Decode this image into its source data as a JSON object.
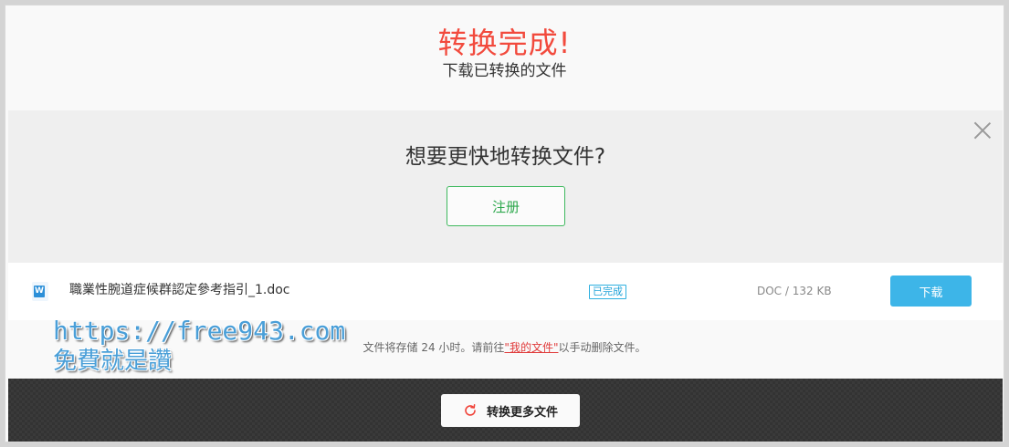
{
  "header": {
    "title": "转换完成!",
    "subtitle": "下载已转换的文件"
  },
  "promo": {
    "title": "想要更快地转换文件?",
    "register_label": "注册",
    "close_icon": "close-icon"
  },
  "file": {
    "icon": "word-doc-icon",
    "name": "職業性腕道症候群認定參考指引_1.doc",
    "status": "已完成",
    "meta": "DOC / 132 KB",
    "download_label": "下载"
  },
  "storage_note": {
    "prefix": "文件将存储 24 小时。请前往",
    "link": "\"我的文件\"",
    "suffix": "以手动删除文件。"
  },
  "watermark": {
    "line1": "https://free943.com",
    "line2": "免費就是讚"
  },
  "bottom_bar": {
    "convert_more_label": "转换更多文件",
    "icon": "refresh-icon"
  },
  "colors": {
    "title_red": "#f24a3d",
    "register_green": "#3fb95e",
    "download_blue": "#3db5e8",
    "link_red": "#e03a3a"
  }
}
